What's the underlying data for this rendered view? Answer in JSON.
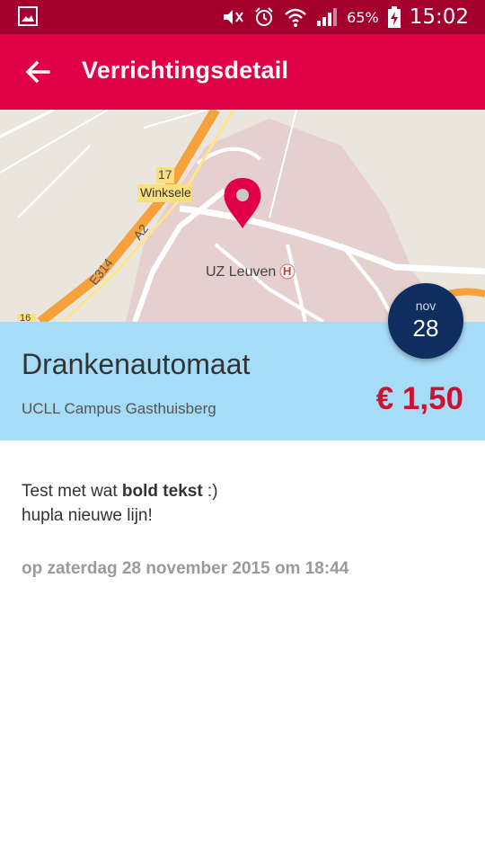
{
  "status_bar": {
    "battery_percent": "65%",
    "time": "15:02",
    "icons": [
      "image-icon",
      "mute-icon",
      "alarm-icon",
      "wifi-icon",
      "signal-icon",
      "battery-charging-icon"
    ]
  },
  "app_bar": {
    "title": "Verrichtingsdetail",
    "back_icon": "arrow-left-icon"
  },
  "map": {
    "labels": {
      "exit_number": "17",
      "town": "Winksele",
      "road_a2": "A2",
      "road_e314": "E314",
      "hospital": "UZ Leuven",
      "hospital_symbol": "H",
      "exit_partial": "16"
    },
    "pin_icon": "map-pin-icon"
  },
  "date_badge": {
    "month": "nov",
    "day": "28"
  },
  "transaction": {
    "merchant": "Drankenautomaat",
    "location": "UCLL Campus Gasthuisberg",
    "amount": "€ 1,50"
  },
  "description": {
    "line1_prefix": "Test met wat ",
    "line1_bold": "bold tekst",
    "line1_suffix": " :)",
    "line2": "hupla nieuwe lijn!"
  },
  "timestamp": "op zaterdag 28 november 2015 om 18:44",
  "colors": {
    "status_bar": "#a3002e",
    "app_bar": "#e10047",
    "info_panel": "#a7dcf8",
    "amount": "#d0102f",
    "date_badge": "#0f2d5e"
  }
}
